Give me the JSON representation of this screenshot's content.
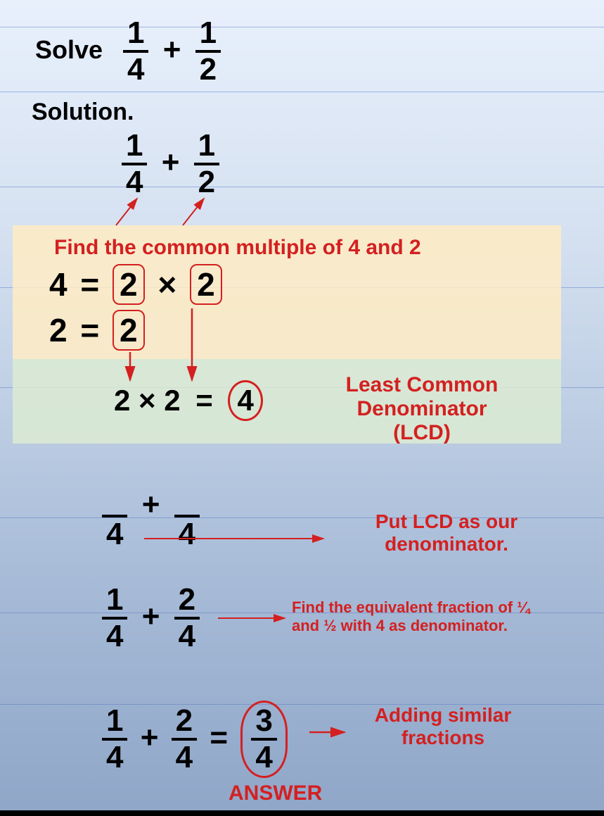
{
  "problem": {
    "solve_label": "Solve",
    "solution_label": "Solution.",
    "f1_num": "1",
    "f1_den": "4",
    "plus": "+",
    "f2_num": "1",
    "f2_den": "2"
  },
  "step_factor": {
    "instruction": "Find the common multiple of 4 and 2",
    "line1_left": "4",
    "eq": "=",
    "times": "×",
    "factor_2a": "2",
    "factor_2b": "2",
    "line2_left": "2",
    "line2_factor": "2"
  },
  "step_lcd": {
    "expr_left": "2 × 2",
    "eq": "=",
    "result": "4",
    "label_line1": "Least Common Denominator",
    "label_line2": "(LCD)"
  },
  "step_put_lcd": {
    "den1": "4",
    "plus": "+",
    "den2": "4",
    "note_line1": "Put LCD as our",
    "note_line2": "denominator."
  },
  "step_equiv": {
    "f1_num": "1",
    "f1_den": "4",
    "plus": "+",
    "f2_num": "2",
    "f2_den": "4",
    "note_line1": "Find the equivalent fraction of ¼",
    "note_line2": "and ½ with 4 as denominator."
  },
  "step_add": {
    "f1_num": "1",
    "f1_den": "4",
    "plus": "+",
    "f2_num": "2",
    "f2_den": "4",
    "eq": "=",
    "ans_num": "3",
    "ans_den": "4",
    "note_line1": "Adding similar",
    "note_line2": "fractions",
    "answer_label": "ANSWER"
  }
}
